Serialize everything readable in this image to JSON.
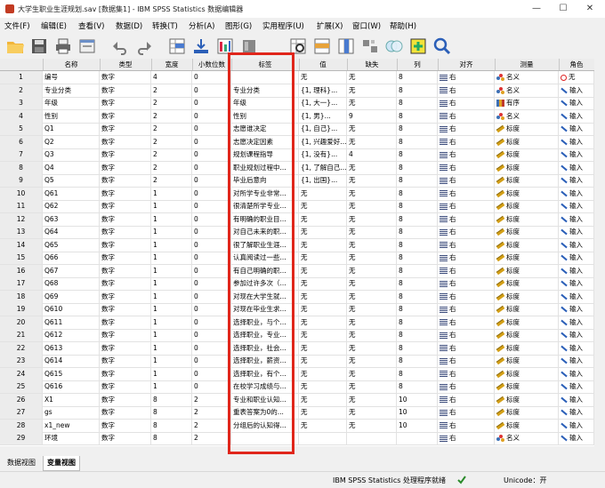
{
  "window": {
    "title": "大学生职业生涯规划.sav [数据集1] - IBM SPSS Statistics 数据编辑器",
    "controls": [
      "—",
      "☐",
      "✕"
    ]
  },
  "menu": [
    "文件(F)",
    "编辑(E)",
    "查看(V)",
    "数据(D)",
    "转换(T)",
    "分析(A)",
    "图形(G)",
    "实用程序(U)",
    "扩展(X)",
    "窗口(W)",
    "帮助(H)"
  ],
  "toolbar_icons": [
    "open-folder-icon",
    "save-icon",
    "print-icon",
    "recall-dialog-icon",
    "undo-icon",
    "redo-icon",
    "goto-case-icon",
    "goto-variable-icon",
    "variables-icon",
    "run-descriptives-icon",
    "find-icon",
    "insert-cases-icon",
    "insert-variable-icon",
    "split-file-icon",
    "weight-cases-icon",
    "select-cases-icon",
    "value-labels-icon",
    "use-sets-icon",
    "show-all-variables-icon",
    "spelling-icon"
  ],
  "columns": [
    "名称",
    "类型",
    "宽度",
    "小数位数",
    "标签",
    "值",
    "缺失",
    "列",
    "对齐",
    "测量",
    "角色"
  ],
  "rows": [
    [
      "1",
      "编号",
      "数字",
      "4",
      "0",
      "",
      "无",
      "无",
      "8",
      "右",
      "名义",
      "无"
    ],
    [
      "2",
      "专业分类",
      "数字",
      "2",
      "0",
      "专业分类",
      "{1, 理科}...",
      "无",
      "8",
      "右",
      "名义",
      "输入"
    ],
    [
      "3",
      "年级",
      "数字",
      "2",
      "0",
      "年级",
      "{1, 大一}...",
      "无",
      "8",
      "右",
      "有序",
      "输入"
    ],
    [
      "4",
      "性别",
      "数字",
      "2",
      "0",
      "性别",
      "{1, 男}...",
      "9",
      "8",
      "右",
      "名义",
      "输入"
    ],
    [
      "5",
      "Q1",
      "数字",
      "2",
      "0",
      "志愿谁决定",
      "{1, 自己}...",
      "无",
      "8",
      "右",
      "标度",
      "输入"
    ],
    [
      "6",
      "Q2",
      "数字",
      "2",
      "0",
      "志愿决定因素",
      "{1, 兴趣爱好...",
      "无",
      "8",
      "右",
      "标度",
      "输入"
    ],
    [
      "7",
      "Q3",
      "数字",
      "2",
      "0",
      "规划课程指导",
      "{1, 没有}...",
      "4",
      "8",
      "右",
      "标度",
      "输入"
    ],
    [
      "8",
      "Q4",
      "数字",
      "2",
      "0",
      "职业规划过程中...",
      "{1, 了解自己...",
      "无",
      "8",
      "右",
      "标度",
      "输入"
    ],
    [
      "9",
      "Q5",
      "数字",
      "2",
      "0",
      "毕业后意向",
      "{1, 出国}...",
      "无",
      "8",
      "右",
      "标度",
      "输入"
    ],
    [
      "10",
      "Q61",
      "数字",
      "1",
      "0",
      "对所学专业非常...",
      "无",
      "无",
      "8",
      "右",
      "标度",
      "输入"
    ],
    [
      "11",
      "Q62",
      "数字",
      "1",
      "0",
      "很清楚所学专业...",
      "无",
      "无",
      "8",
      "右",
      "标度",
      "输入"
    ],
    [
      "12",
      "Q63",
      "数字",
      "1",
      "0",
      "有明确的职业目...",
      "无",
      "无",
      "8",
      "右",
      "标度",
      "输入"
    ],
    [
      "13",
      "Q64",
      "数字",
      "1",
      "0",
      "对自己未来的职...",
      "无",
      "无",
      "8",
      "右",
      "标度",
      "输入"
    ],
    [
      "14",
      "Q65",
      "数字",
      "1",
      "0",
      "很了解职业生涯...",
      "无",
      "无",
      "8",
      "右",
      "标度",
      "输入"
    ],
    [
      "15",
      "Q66",
      "数字",
      "1",
      "0",
      "认真阅读过一些...",
      "无",
      "无",
      "8",
      "右",
      "标度",
      "输入"
    ],
    [
      "16",
      "Q67",
      "数字",
      "1",
      "0",
      "有自己明确的职...",
      "无",
      "无",
      "8",
      "右",
      "标度",
      "输入"
    ],
    [
      "17",
      "Q68",
      "数字",
      "1",
      "0",
      "参加过许多次（...",
      "无",
      "无",
      "8",
      "右",
      "标度",
      "输入"
    ],
    [
      "18",
      "Q69",
      "数字",
      "1",
      "0",
      "对现在大学生就...",
      "无",
      "无",
      "8",
      "右",
      "标度",
      "输入"
    ],
    [
      "19",
      "Q610",
      "数字",
      "1",
      "0",
      "对现在毕业生求...",
      "无",
      "无",
      "8",
      "右",
      "标度",
      "输入"
    ],
    [
      "20",
      "Q611",
      "数字",
      "1",
      "0",
      "选择职业，与个...",
      "无",
      "无",
      "8",
      "右",
      "标度",
      "输入"
    ],
    [
      "21",
      "Q612",
      "数字",
      "1",
      "0",
      "选择职业，专业...",
      "无",
      "无",
      "8",
      "右",
      "标度",
      "输入"
    ],
    [
      "22",
      "Q613",
      "数字",
      "1",
      "0",
      "选择职业，社会...",
      "无",
      "无",
      "8",
      "右",
      "标度",
      "输入"
    ],
    [
      "23",
      "Q614",
      "数字",
      "1",
      "0",
      "选择职业，薪资...",
      "无",
      "无",
      "8",
      "右",
      "标度",
      "输入"
    ],
    [
      "24",
      "Q615",
      "数字",
      "1",
      "0",
      "选择职业，有个...",
      "无",
      "无",
      "8",
      "右",
      "标度",
      "输入"
    ],
    [
      "25",
      "Q616",
      "数字",
      "1",
      "0",
      "在校学习成绩与...",
      "无",
      "无",
      "8",
      "右",
      "标度",
      "输入"
    ],
    [
      "26",
      "X1",
      "数字",
      "8",
      "2",
      "专业和职业认知...",
      "无",
      "无",
      "10",
      "右",
      "标度",
      "输入"
    ],
    [
      "27",
      "gs",
      "数字",
      "8",
      "2",
      "重表答案为0的...",
      "无",
      "无",
      "10",
      "右",
      "标度",
      "输入"
    ],
    [
      "28",
      "x1_new",
      "数字",
      "8",
      "2",
      "分组后的认知得...",
      "无",
      "无",
      "10",
      "右",
      "标度",
      "输入"
    ],
    [
      "29",
      "环境",
      "数字",
      "8",
      "2",
      "",
      "",
      "",
      "",
      "右",
      "名义",
      "输入"
    ]
  ],
  "tabs": [
    "数据视图",
    "变量视图"
  ],
  "active_tab": "变量视图",
  "status": {
    "processor": "IBM SPSS Statistics 处理程序就绪",
    "unicode": "Unicode：开"
  },
  "colors": {
    "highlight_border": "#e0261b",
    "align_icon": "#3a4a7a",
    "scale_icon": "#d4a017"
  }
}
